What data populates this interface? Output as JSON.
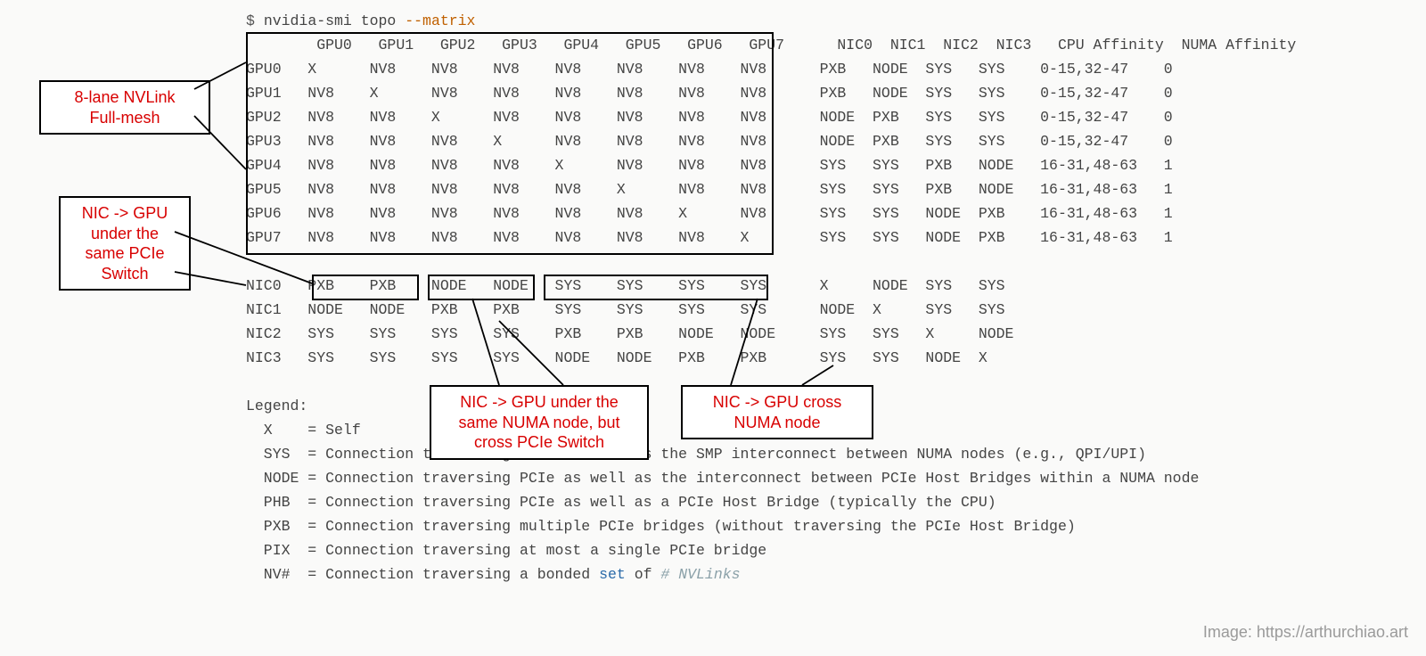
{
  "command": {
    "prompt": "$ ",
    "text": "nvidia-smi topo ",
    "flag": "--matrix"
  },
  "headers": {
    "gpus": [
      "GPU0",
      "GPU1",
      "GPU2",
      "GPU3",
      "GPU4",
      "GPU5",
      "GPU6",
      "GPU7"
    ],
    "nics": [
      "NIC0",
      "NIC1",
      "NIC2",
      "NIC3"
    ],
    "aff_cpu": "CPU Affinity",
    "aff_numa": "NUMA Affinity"
  },
  "gpu_rows": [
    {
      "lbl": "GPU0",
      "g": [
        "X",
        "NV8",
        "NV8",
        "NV8",
        "NV8",
        "NV8",
        "NV8",
        "NV8"
      ],
      "n": [
        "PXB",
        "NODE",
        "SYS",
        "SYS"
      ],
      "cpu": "0-15,32-47",
      "numa": "0"
    },
    {
      "lbl": "GPU1",
      "g": [
        "NV8",
        "X",
        "NV8",
        "NV8",
        "NV8",
        "NV8",
        "NV8",
        "NV8"
      ],
      "n": [
        "PXB",
        "NODE",
        "SYS",
        "SYS"
      ],
      "cpu": "0-15,32-47",
      "numa": "0"
    },
    {
      "lbl": "GPU2",
      "g": [
        "NV8",
        "NV8",
        "X",
        "NV8",
        "NV8",
        "NV8",
        "NV8",
        "NV8"
      ],
      "n": [
        "NODE",
        "PXB",
        "SYS",
        "SYS"
      ],
      "cpu": "0-15,32-47",
      "numa": "0"
    },
    {
      "lbl": "GPU3",
      "g": [
        "NV8",
        "NV8",
        "NV8",
        "X",
        "NV8",
        "NV8",
        "NV8",
        "NV8"
      ],
      "n": [
        "NODE",
        "PXB",
        "SYS",
        "SYS"
      ],
      "cpu": "0-15,32-47",
      "numa": "0"
    },
    {
      "lbl": "GPU4",
      "g": [
        "NV8",
        "NV8",
        "NV8",
        "NV8",
        "X",
        "NV8",
        "NV8",
        "NV8"
      ],
      "n": [
        "SYS",
        "SYS",
        "PXB",
        "NODE"
      ],
      "cpu": "16-31,48-63",
      "numa": "1"
    },
    {
      "lbl": "GPU5",
      "g": [
        "NV8",
        "NV8",
        "NV8",
        "NV8",
        "NV8",
        "X",
        "NV8",
        "NV8"
      ],
      "n": [
        "SYS",
        "SYS",
        "PXB",
        "NODE"
      ],
      "cpu": "16-31,48-63",
      "numa": "1"
    },
    {
      "lbl": "GPU6",
      "g": [
        "NV8",
        "NV8",
        "NV8",
        "NV8",
        "NV8",
        "NV8",
        "X",
        "NV8"
      ],
      "n": [
        "SYS",
        "SYS",
        "NODE",
        "PXB"
      ],
      "cpu": "16-31,48-63",
      "numa": "1"
    },
    {
      "lbl": "GPU7",
      "g": [
        "NV8",
        "NV8",
        "NV8",
        "NV8",
        "NV8",
        "NV8",
        "NV8",
        "X"
      ],
      "n": [
        "SYS",
        "SYS",
        "NODE",
        "PXB"
      ],
      "cpu": "16-31,48-63",
      "numa": "1"
    }
  ],
  "nic_rows": [
    {
      "lbl": "NIC0",
      "g": [
        "PXB",
        "PXB",
        "NODE",
        "NODE",
        "SYS",
        "SYS",
        "SYS",
        "SYS"
      ],
      "n": [
        "X",
        "NODE",
        "SYS",
        "SYS"
      ]
    },
    {
      "lbl": "NIC1",
      "g": [
        "NODE",
        "NODE",
        "PXB",
        "PXB",
        "SYS",
        "SYS",
        "SYS",
        "SYS"
      ],
      "n": [
        "NODE",
        "X",
        "SYS",
        "SYS"
      ]
    },
    {
      "lbl": "NIC2",
      "g": [
        "SYS",
        "SYS",
        "SYS",
        "SYS",
        "PXB",
        "PXB",
        "NODE",
        "NODE"
      ],
      "n": [
        "SYS",
        "SYS",
        "X",
        "NODE"
      ]
    },
    {
      "lbl": "NIC3",
      "g": [
        "SYS",
        "SYS",
        "SYS",
        "SYS",
        "NODE",
        "NODE",
        "PXB",
        "PXB"
      ],
      "n": [
        "SYS",
        "SYS",
        "NODE",
        "X"
      ]
    }
  ],
  "legend": {
    "title": "Legend:",
    "items": [
      {
        "k": "X",
        "v": "= Self"
      },
      {
        "k": "SYS",
        "v": "= Connection traversing PCIe as well as the SMP interconnect between NUMA nodes (e.g., QPI/UPI)"
      },
      {
        "k": "NODE",
        "v": "= Connection traversing PCIe as well as the interconnect between PCIe Host Bridges within a NUMA node"
      },
      {
        "k": "PHB",
        "v": "= Connection traversing PCIe as well as a PCIe Host Bridge (typically the CPU)"
      },
      {
        "k": "PXB",
        "v": "= Connection traversing multiple PCIe bridges (without traversing the PCIe Host Bridge)"
      },
      {
        "k": "PIX",
        "v": "= Connection traversing at most a single PCIe bridge"
      },
      {
        "k": "NV#",
        "v_pre": "= Connection traversing a bonded ",
        "v_kw": "set",
        "v_post": " of ",
        "v_comment": "# NVLinks"
      }
    ]
  },
  "callouts": {
    "nvlink": "8-lane NVLink\nFull-mesh",
    "pcie_sw": "NIC -> GPU\nunder the\nsame PCIe\nSwitch",
    "numa_same": "NIC -> GPU under the\nsame NUMA node, but\ncross PCIe Switch",
    "numa_cross": "NIC -> GPU cross\nNUMA node"
  },
  "attribution": "Image: https://arthurchiao.art"
}
